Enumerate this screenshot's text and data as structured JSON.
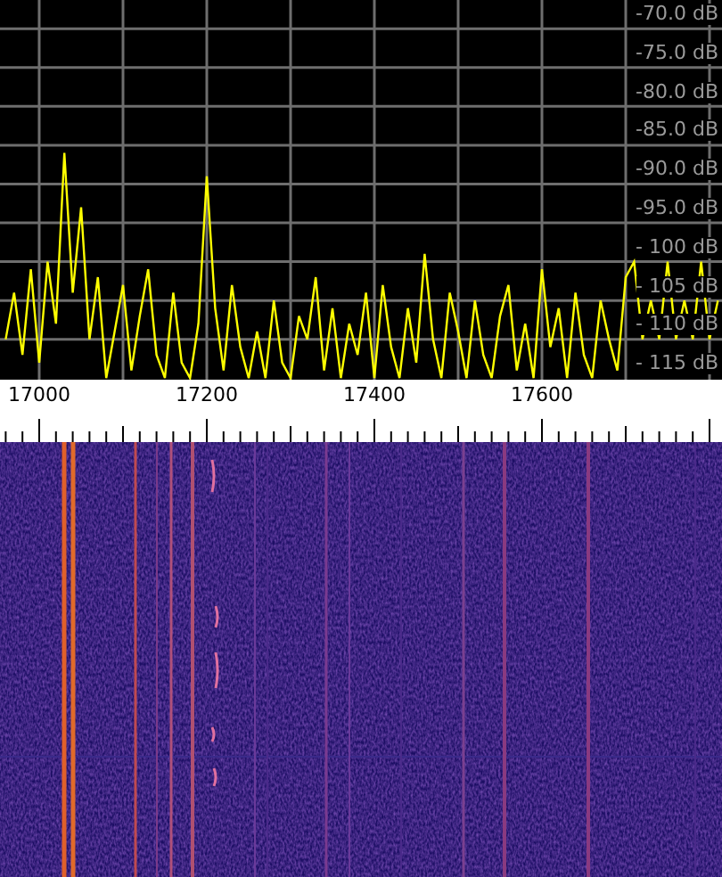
{
  "spectrum": {
    "chart_data": {
      "type": "line",
      "x": [
        16960,
        16970,
        16980,
        16990,
        17000,
        17010,
        17020,
        17030,
        17040,
        17050,
        17060,
        17070,
        17080,
        17090,
        17100,
        17110,
        17120,
        17130,
        17140,
        17150,
        17160,
        17170,
        17180,
        17190,
        17200,
        17210,
        17220,
        17230,
        17240,
        17250,
        17260,
        17270,
        17280,
        17290,
        17300,
        17310,
        17320,
        17330,
        17340,
        17350,
        17360,
        17370,
        17380,
        17390,
        17400,
        17410,
        17420,
        17430,
        17440,
        17450,
        17460,
        17470,
        17480,
        17490,
        17500,
        17510,
        17520,
        17530,
        17540,
        17550,
        17560,
        17570,
        17580,
        17590,
        17600,
        17610,
        17620,
        17630,
        17640,
        17650,
        17660,
        17670,
        17680,
        17690,
        17700,
        17710,
        17720,
        17730,
        17740,
        17750,
        17760,
        17770,
        17780,
        17790,
        17800,
        17810
      ],
      "series": [
        {
          "color": "#ffff00",
          "values": [
            -110,
            -104,
            -112,
            -101,
            -113,
            -100,
            -108,
            -86,
            -104,
            -93,
            -110,
            -102,
            -115,
            -109,
            -103,
            -114,
            -107,
            -101,
            -112,
            -115,
            -104,
            -113,
            -115,
            -108,
            -89,
            -106,
            -114,
            -103,
            -111,
            -115,
            -109,
            -115,
            -105,
            -113,
            -115,
            -107,
            -110,
            -102,
            -114,
            -106,
            -115,
            -108,
            -112,
            -104,
            -115,
            -103,
            -111,
            -115,
            -106,
            -113,
            -99,
            -110,
            -115,
            -104,
            -109,
            -115,
            -105,
            -112,
            -115,
            -107,
            -103,
            -114,
            -108,
            -115,
            -101,
            -111,
            -106,
            -115,
            -104,
            -112,
            -115,
            -105,
            -110,
            -114,
            -102,
            -100,
            -110,
            -105,
            -110,
            -100,
            -110,
            -105,
            -110,
            -100,
            -110,
            -105
          ]
        }
      ],
      "xlim": [
        16953.2,
        17814.9
      ],
      "ylim": [
        -115.2,
        -66.3
      ],
      "xticks": [
        17000,
        17200,
        17400,
        17600
      ],
      "grid": true,
      "yticks": [
        {
          "value": -70,
          "label": "-70.0 dB"
        },
        {
          "value": -75,
          "label": "-75.0 dB"
        },
        {
          "value": -80,
          "label": "-80.0 dB"
        },
        {
          "value": -85,
          "label": "-85.0 dB"
        },
        {
          "value": -90,
          "label": "-90.0 dB"
        },
        {
          "value": -95,
          "label": "-95.0 dB"
        },
        {
          "value": -100,
          "label": "- 100 dB"
        },
        {
          "value": -105,
          "label": "- 105 dB"
        },
        {
          "value": -110,
          "label": "- 110 dB"
        },
        {
          "value": -115,
          "label": "- 115 dB"
        }
      ]
    }
  }
}
